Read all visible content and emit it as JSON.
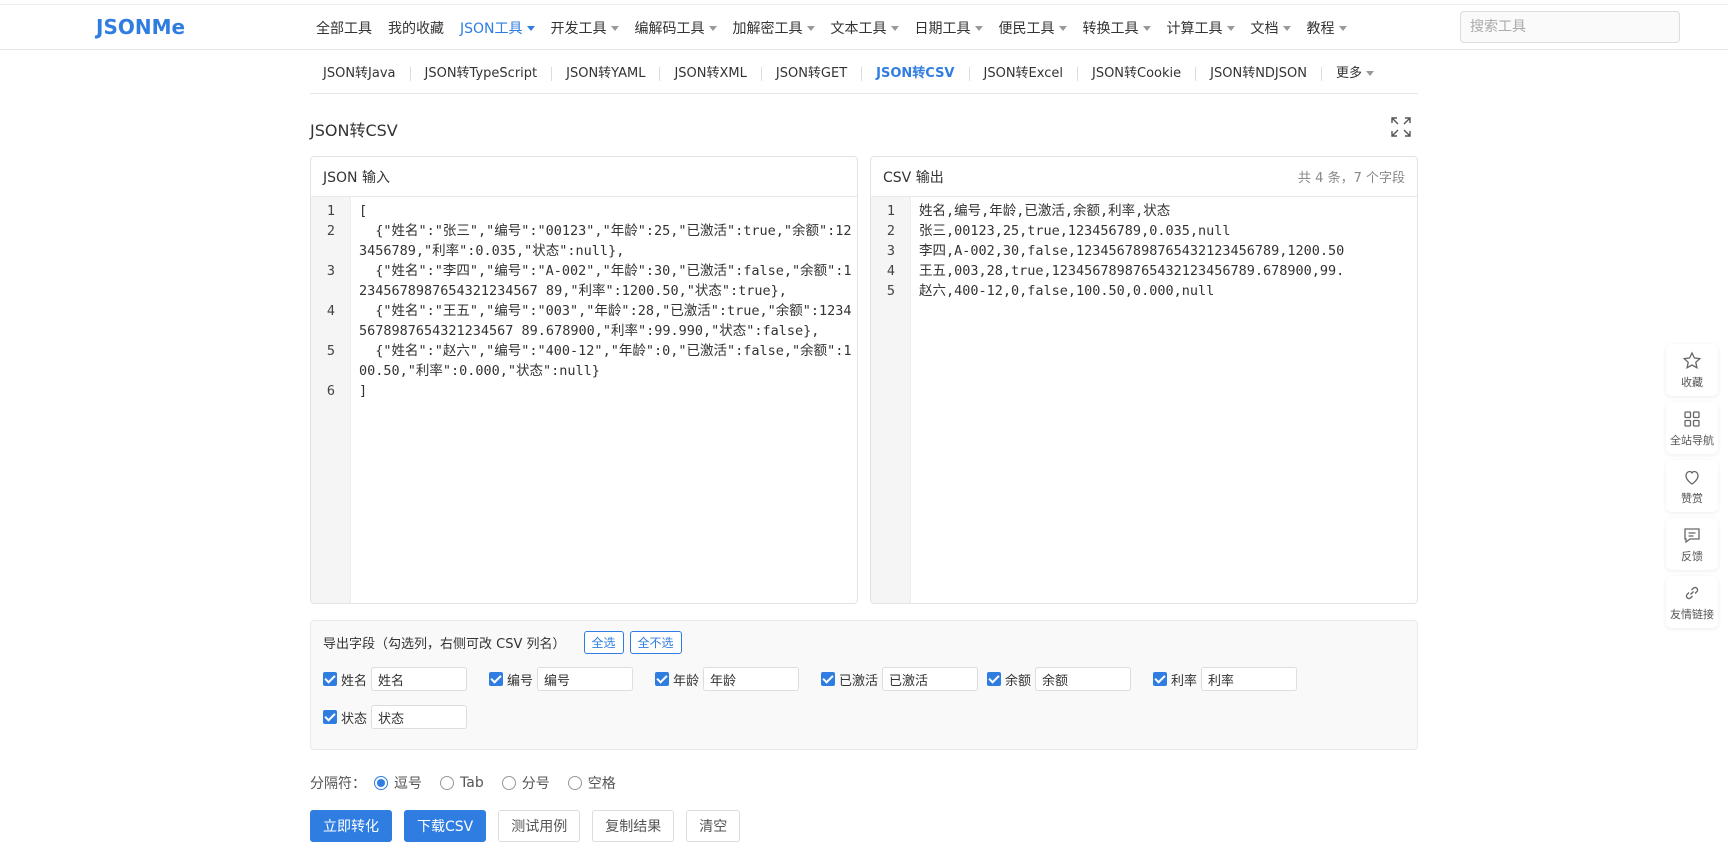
{
  "brand": "JSONMe",
  "main_menu": [
    {
      "label": "全部工具",
      "caret": false,
      "active": false
    },
    {
      "label": "我的收藏",
      "caret": false,
      "active": false
    },
    {
      "label": "JSON工具",
      "caret": true,
      "active": true
    },
    {
      "label": "开发工具",
      "caret": true,
      "active": false
    },
    {
      "label": "编解码工具",
      "caret": true,
      "active": false
    },
    {
      "label": "加解密工具",
      "caret": true,
      "active": false
    },
    {
      "label": "文本工具",
      "caret": true,
      "active": false
    },
    {
      "label": "日期工具",
      "caret": true,
      "active": false
    },
    {
      "label": "便民工具",
      "caret": true,
      "active": false
    },
    {
      "label": "转换工具",
      "caret": true,
      "active": false
    },
    {
      "label": "计算工具",
      "caret": true,
      "active": false
    },
    {
      "label": "文档",
      "caret": true,
      "active": false
    },
    {
      "label": "教程",
      "caret": true,
      "active": false
    }
  ],
  "search": {
    "placeholder": "搜索工具"
  },
  "sub_menu": [
    {
      "label": "JSON转Java",
      "active": false
    },
    {
      "label": "JSON转TypeScript",
      "active": false
    },
    {
      "label": "JSON转YAML",
      "active": false
    },
    {
      "label": "JSON转XML",
      "active": false
    },
    {
      "label": "JSON转GET",
      "active": false
    },
    {
      "label": "JSON转CSV",
      "active": true
    },
    {
      "label": "JSON转Excel",
      "active": false
    },
    {
      "label": "JSON转Cookie",
      "active": false
    },
    {
      "label": "JSON转NDJSON",
      "active": false
    },
    {
      "label": "更多",
      "active": false,
      "caret": true
    }
  ],
  "page_title": "JSON转CSV",
  "input_panel": {
    "title": "JSON 输入",
    "lines": [
      "[",
      "  {\"姓名\":\"张三\",\"编号\":\"00123\",\"年龄\":25,\"已激活\":true,\"余额\":123456789,\"利率\":0.035,\"状态\":null},",
      "  {\"姓名\":\"李四\",\"编号\":\"A-002\",\"年龄\":30,\"已激活\":false,\"余额\":12345678987654321234567 89,\"利率\":1200.50,\"状态\":true},",
      "  {\"姓名\":\"王五\",\"编号\":\"003\",\"年龄\":28,\"已激活\":true,\"余额\":12345678987654321234567 89.678900,\"利率\":99.990,\"状态\":false},",
      "  {\"姓名\":\"赵六\",\"编号\":\"400-12\",\"年龄\":0,\"已激活\":false,\"余额\":100.50,\"利率\":0.000,\"状态\":null}",
      "]"
    ]
  },
  "output_panel": {
    "title": "CSV 输出",
    "meta": "共 4 条，7 个字段",
    "lines": [
      "姓名,编号,年龄,已激活,余额,利率,状态",
      "张三,00123,25,true,123456789,0.035,null",
      "李四,A-002,30,false,1234567898765432123456789,1200.50",
      "王五,003,28,true,1234567898765432123456789.678900,99.",
      "赵六,400-12,0,false,100.50,0.000,null"
    ]
  },
  "fields": {
    "title": "导出字段（勾选列，右侧可改 CSV 列名）",
    "select_all": "全选",
    "select_none": "全不选",
    "items": [
      {
        "label": "姓名",
        "value": "姓名",
        "checked": true
      },
      {
        "label": "编号",
        "value": "编号",
        "checked": true
      },
      {
        "label": "年龄",
        "value": "年龄",
        "checked": true
      },
      {
        "label": "已激活",
        "value": "已激活",
        "checked": true
      },
      {
        "label": "余额",
        "value": "余额",
        "checked": true
      },
      {
        "label": "利率",
        "value": "利率",
        "checked": true
      },
      {
        "label": "状态",
        "value": "状态",
        "checked": true
      }
    ]
  },
  "delimiter": {
    "label": "分隔符：",
    "options": [
      {
        "label": "逗号",
        "selected": true
      },
      {
        "label": "Tab",
        "selected": false
      },
      {
        "label": "分号",
        "selected": false
      },
      {
        "label": "空格",
        "selected": false
      }
    ]
  },
  "actions": {
    "convert": "立即转化",
    "download": "下载CSV",
    "sample": "测试用例",
    "copy": "复制结果",
    "clear": "清空"
  },
  "side_tools": [
    {
      "label": "收藏",
      "icon": "star-icon"
    },
    {
      "label": "全站导航",
      "icon": "grid-icon"
    },
    {
      "label": "赞赏",
      "icon": "heart-icon"
    },
    {
      "label": "反馈",
      "icon": "message-icon"
    },
    {
      "label": "友情链接",
      "icon": "link-icon"
    }
  ],
  "colors": {
    "accent": "#2f7de1"
  }
}
